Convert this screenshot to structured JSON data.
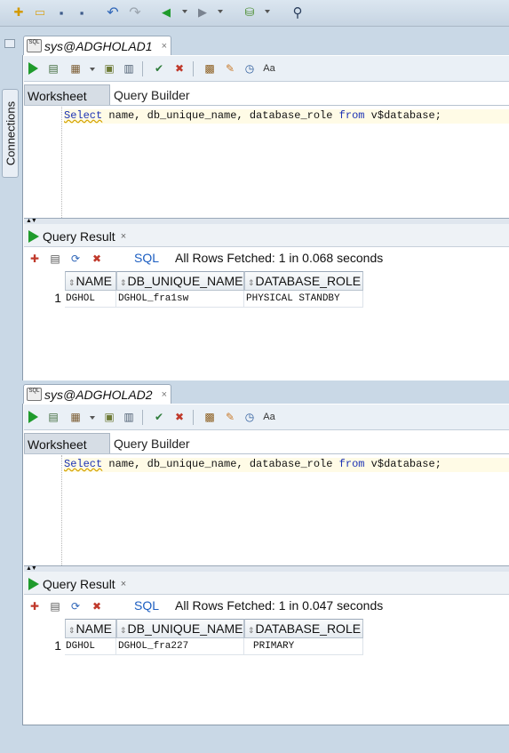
{
  "main_toolbar": {
    "buttons": [
      {
        "name": "new-icon",
        "glyph": "✚"
      },
      {
        "name": "open-folder-icon",
        "glyph": "▭"
      },
      {
        "name": "save-icon",
        "glyph": "▪"
      },
      {
        "name": "save-all-icon",
        "glyph": "▪"
      },
      {
        "name": "undo-icon",
        "glyph": "↶"
      },
      {
        "name": "redo-icon",
        "glyph": "↷"
      },
      {
        "name": "back-icon",
        "glyph": "◀"
      },
      {
        "name": "forward-icon",
        "glyph": "▶"
      },
      {
        "name": "sql-connection-icon",
        "glyph": "⛁"
      },
      {
        "name": "binoculars-icon",
        "glyph": "⚲"
      }
    ]
  },
  "side_panel": {
    "connections_label": "Connections"
  },
  "worksheets": [
    {
      "tab_label": "sys@ADGHOLAD1",
      "tab_close": "×",
      "tab_icon_text": "SQL",
      "worksheet_tab": "Worksheet",
      "query_builder_tab": "Query Builder",
      "sql": {
        "kw_select": "Select",
        "kw_from": "from",
        "part1": " name, db_unique_name, database_role ",
        "part2": " v$database;"
      },
      "result": {
        "tab_label": "Query Result",
        "tab_close": "×",
        "sql_link": "SQL",
        "fetch_message": "All Rows Fetched: 1 in 0.068 seconds",
        "columns": [
          "NAME",
          "DB_UNIQUE_NAME",
          "DATABASE_ROLE"
        ],
        "rows": [
          {
            "num": "1",
            "cells": [
              "DGHOL",
              "DGHOL_fra1sw",
              "PHYSICAL STANDBY"
            ]
          }
        ]
      }
    },
    {
      "tab_label": "sys@ADGHOLAD2",
      "tab_close": "×",
      "tab_icon_text": "SQL",
      "worksheet_tab": "Worksheet",
      "query_builder_tab": "Query Builder",
      "sql": {
        "kw_select": "Select",
        "kw_from": "from",
        "part1": " name, db_unique_name, database_role ",
        "part2": " v$database;"
      },
      "result": {
        "tab_label": "Query Result",
        "tab_close": "×",
        "sql_link": "SQL",
        "fetch_message": "All Rows Fetched: 1 in 0.047 seconds",
        "columns": [
          "NAME",
          "DB_UNIQUE_NAME",
          "DATABASE_ROLE"
        ],
        "rows": [
          {
            "num": "1",
            "cells": [
              "DGHOL",
              "DGHOL_fra227",
              "PRIMARY"
            ]
          }
        ]
      }
    }
  ],
  "sort_glyph": "⇕",
  "splitter_glyph": "▲▼",
  "colors": {
    "run_green": "#1f9b2c",
    "sql_keyword": "#1d33b4",
    "link_blue": "#1c5ec1"
  }
}
